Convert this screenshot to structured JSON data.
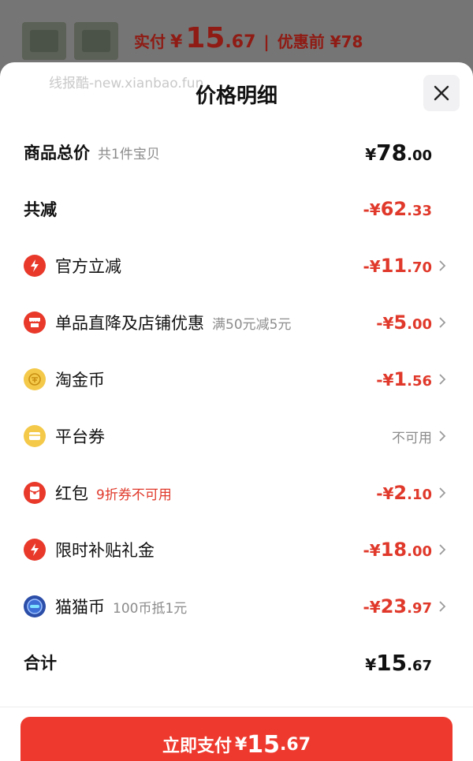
{
  "background": {
    "paid_label": "实付",
    "currency": "¥",
    "paid_int": "15",
    "paid_dec": ".67",
    "separator": "|",
    "before_discount": "优惠前 ¥78"
  },
  "watermark": "线报酷-new.xianbao.fun",
  "sheet": {
    "title": "价格明细"
  },
  "rows": [
    {
      "label": "商品总价",
      "note": "共1件宝贝",
      "currency": "¥",
      "int": "78",
      "dec": ".00"
    },
    {
      "label": "共减",
      "currency": "-¥",
      "int": "62",
      "dec": ".33"
    },
    {
      "label": "官方立减",
      "icon": "lightning-icon",
      "currency": "-¥",
      "int": "11",
      "dec": ".70"
    },
    {
      "label": "单品直降及店铺优惠",
      "icon": "store-icon",
      "note": "满50元减5元",
      "currency": "-¥",
      "int": "5",
      "dec": ".00"
    },
    {
      "label": "淘金币",
      "icon": "gold-coin-icon",
      "currency": "-¥",
      "int": "1",
      "dec": ".56"
    },
    {
      "label": "平台券",
      "icon": "coupon-icon",
      "value_text": "不可用"
    },
    {
      "label": "红包",
      "icon": "red-envelope-icon",
      "note": "9折券不可用",
      "currency": "-¥",
      "int": "2",
      "dec": ".10"
    },
    {
      "label": "限时补贴礼金",
      "icon": "lightning-icon",
      "currency": "-¥",
      "int": "18",
      "dec": ".00"
    },
    {
      "label": "猫猫币",
      "icon": "cat-coin-icon",
      "note": "100币抵1元",
      "currency": "-¥",
      "int": "23",
      "dec": ".97"
    },
    {
      "label": "合计",
      "currency": "¥",
      "int": "15",
      "dec": ".67"
    }
  ],
  "pay_button": {
    "label": "立即支付",
    "currency": "¥",
    "int": "15",
    "dec": ".67"
  },
  "colors": {
    "accent": "#ee3a2e",
    "discount_red": "#e0392b",
    "gold": "#f4c94a"
  }
}
